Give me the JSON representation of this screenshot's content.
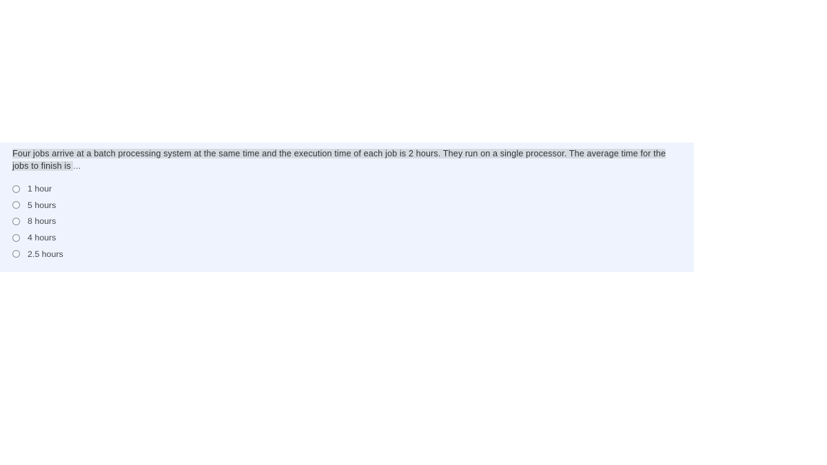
{
  "question": {
    "selected_text": "Four jobs arrive at a batch processing system at the same time and the execution time of each job is 2 hours. They run on a single processor. The average time for the jobs to finish is ",
    "trailing_text": "...",
    "full_text": "Four jobs arrive at a batch processing system at the same time and the execution time of each job is 2 hours. They run on a single processor. The average time for the jobs to finish is ..."
  },
  "options": [
    {
      "label": "1 hour",
      "icon": "radio-unchecked-icon",
      "selected": false
    },
    {
      "label": "5 hours",
      "icon": "radio-unchecked-icon",
      "selected": false
    },
    {
      "label": "8 hours",
      "icon": "radio-unchecked-icon",
      "selected": false
    },
    {
      "label": "4 hours",
      "icon": "radio-unchecked-icon",
      "selected": false
    },
    {
      "label": "2.5 hours",
      "icon": "radio-unchecked-icon",
      "selected": false
    }
  ],
  "colors": {
    "page_background": "#ffffff",
    "card_background": "#eff3fe",
    "selection_highlight": "#d7dbe1",
    "question_text": "#30343a",
    "option_text": "#44484e",
    "radio_border": "#8a8f96"
  }
}
